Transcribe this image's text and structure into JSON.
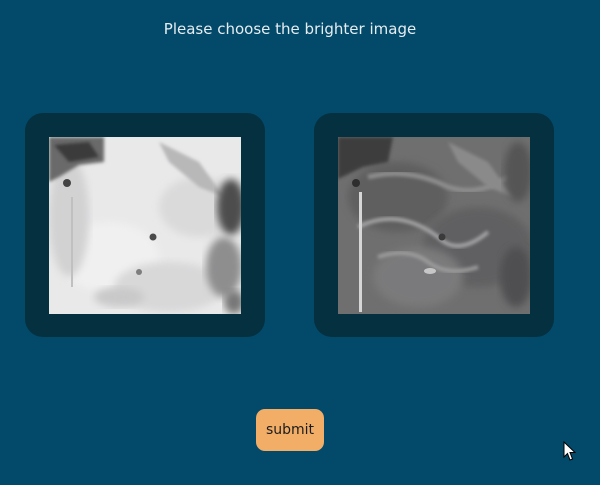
{
  "prompt": {
    "text": "Please choose the brighter image"
  },
  "options": [
    {
      "icon": "bright-aerial-image",
      "tone": "bright"
    },
    {
      "icon": "dark-aerial-image",
      "tone": "dark"
    }
  ],
  "submit": {
    "label": "submit"
  },
  "colors": {
    "background": "#02496a",
    "card": "#05303f",
    "button": "#f2ae67",
    "text": "#e6edf1"
  }
}
